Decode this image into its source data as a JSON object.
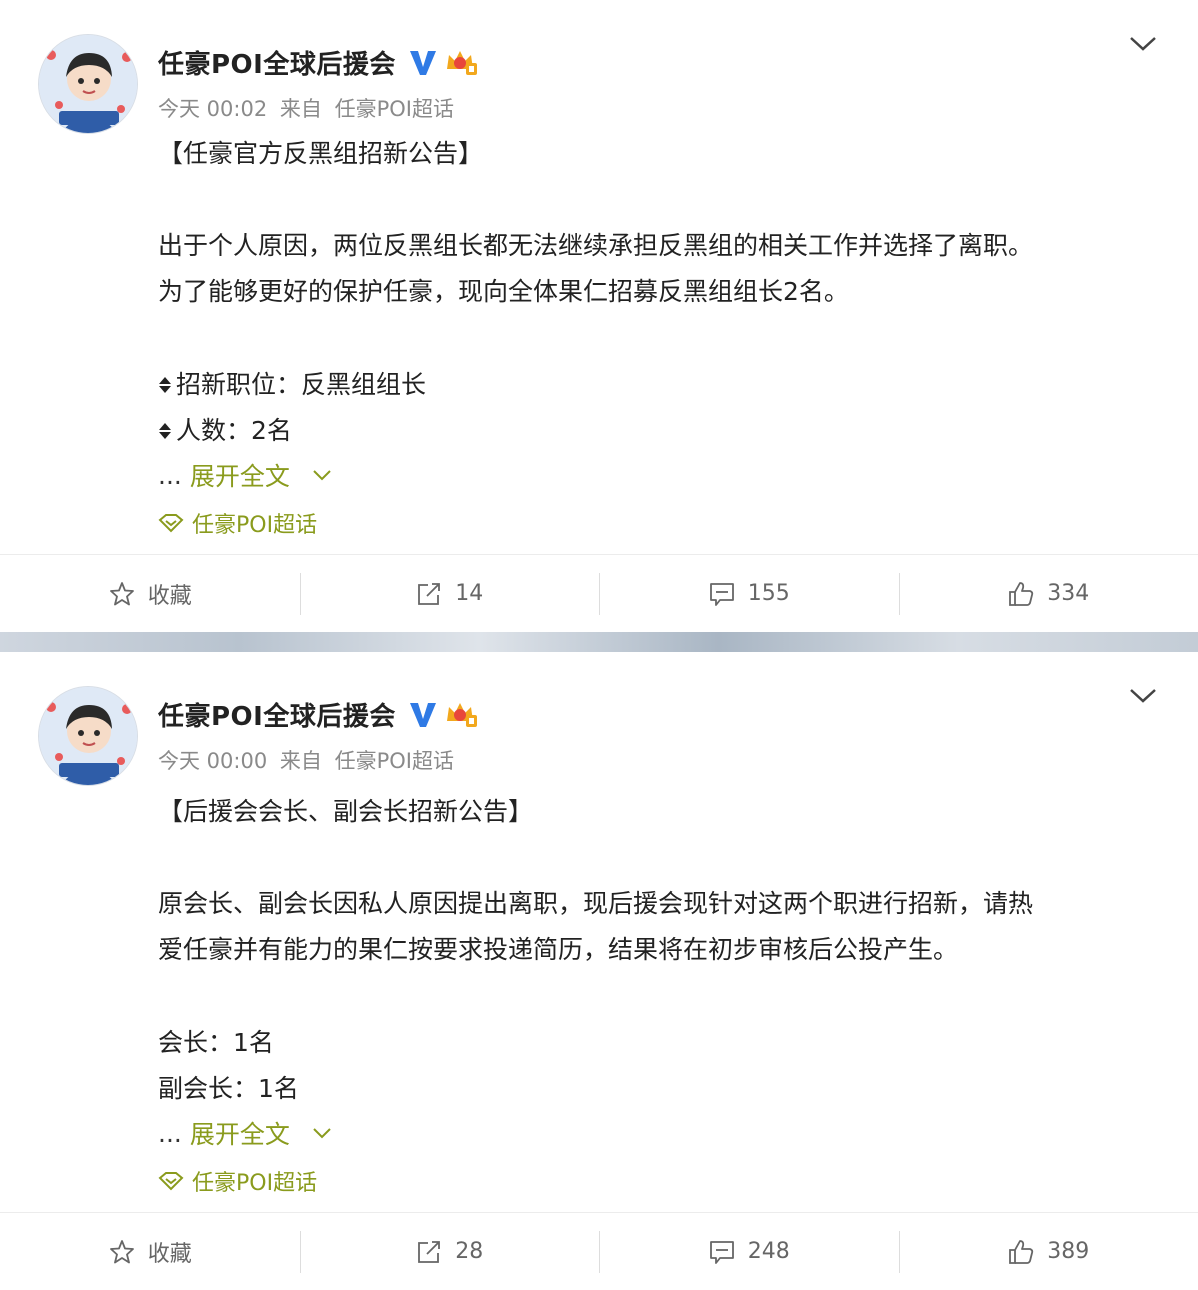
{
  "posts": [
    {
      "author": "任豪POI全球后援会",
      "time": "今天 00:02",
      "source_prefix": "来自",
      "source": "任豪POI超话",
      "title": "【任豪官方反黑组招新公告】",
      "body_lines": [
        "出于个人原因，两位反黑组长都无法继续承担反黑组的相关工作并选择了离职。",
        "为了能够更好的保护任豪，现向全体果仁招募反黑组组长2名。"
      ],
      "items": [
        "招新职位：反黑组组长",
        "人数：2名"
      ],
      "ellipsis": "...",
      "expand_label": "展开全文",
      "topic": "任豪POI超话",
      "actions": {
        "favorite": "收藏",
        "repost": "14",
        "comment": "155",
        "like": "334"
      }
    },
    {
      "author": "任豪POI全球后援会",
      "time": "今天 00:00",
      "source_prefix": "来自",
      "source": "任豪POI超话",
      "title": "【后援会会长、副会长招新公告】",
      "body_lines": [
        "原会长、副会长因私人原因提出离职，现后援会现针对这两个职进行招新，请热",
        "爱任豪并有能力的果仁按要求投递简历，结果将在初步审核后公投产生。"
      ],
      "items": [
        "会长：1名",
        "副会长：1名"
      ],
      "ellipsis": "...",
      "expand_label": "展开全文",
      "topic": "任豪POI超话",
      "actions": {
        "favorite": "收藏",
        "repost": "28",
        "comment": "248",
        "like": "389"
      }
    }
  ],
  "colors": {
    "link": "#8a9b1d",
    "verified": "#2f7ae5",
    "text": "#222222",
    "muted": "#8a8a8a"
  },
  "icons": [
    "chevron-down-icon",
    "verified-v-icon",
    "crown-badge-icon",
    "diamond-bullet-icon",
    "supertopic-icon",
    "star-icon",
    "share-icon",
    "comment-icon",
    "thumbs-up-icon"
  ]
}
